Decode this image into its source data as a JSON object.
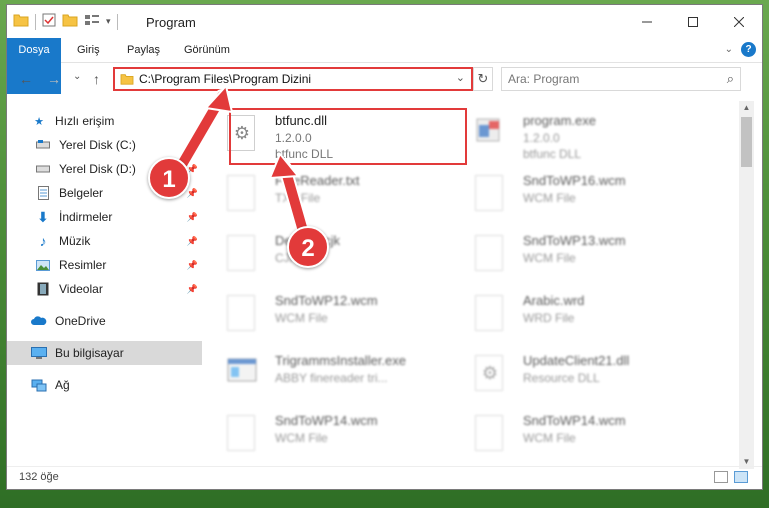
{
  "window": {
    "title": "Program"
  },
  "ribbon": {
    "tabs": [
      "Dosya",
      "Giriş",
      "Paylaş",
      "Görünüm"
    ],
    "help_label": "?"
  },
  "address": {
    "path": "C:\\Program Files\\Program Dizini",
    "search_placeholder": "Ara: Program"
  },
  "nav": {
    "items": [
      {
        "label": "Hızlı erişim",
        "icon": "star-icon",
        "pinned": false
      },
      {
        "label": "Yerel Disk (C:)",
        "icon": "drive-icon",
        "pinned": false
      },
      {
        "label": "Yerel Disk (D:)",
        "icon": "drive-icon",
        "pinned": true
      },
      {
        "label": "Belgeler",
        "icon": "document-icon",
        "pinned": true
      },
      {
        "label": "İndirmeler",
        "icon": "download-icon",
        "pinned": true
      },
      {
        "label": "Müzik",
        "icon": "music-icon",
        "pinned": true
      },
      {
        "label": "Resimler",
        "icon": "image-icon",
        "pinned": true
      },
      {
        "label": "Videolar",
        "icon": "video-icon",
        "pinned": true
      },
      {
        "label": "OneDrive",
        "icon": "cloud-icon",
        "pinned": false
      },
      {
        "label": "Bu bilgisayar",
        "icon": "computer-icon",
        "pinned": false,
        "selected": true
      },
      {
        "label": "Ağ",
        "icon": "network-icon",
        "pinned": false
      }
    ]
  },
  "files": [
    {
      "name": "btfunc.dll",
      "sub1": "1.2.0.0",
      "sub2": "btfunc DLL",
      "highlight": true
    },
    {
      "name": "program.exe",
      "sub1": "1.2.0.0",
      "sub2": "btfunc DLL"
    },
    {
      "name": "FineReader.txt",
      "sub1": "TXT File",
      "sub2": ""
    },
    {
      "name": "SndToWP16.wcm",
      "sub1": "WCM File",
      "sub2": ""
    },
    {
      "name": "De...ont.cjk",
      "sub1": "CJK File",
      "sub2": ""
    },
    {
      "name": "SndToWP13.wcm",
      "sub1": "WCM File",
      "sub2": ""
    },
    {
      "name": "SndToWP12.wcm",
      "sub1": "WCM File",
      "sub2": ""
    },
    {
      "name": "Arabic.wrd",
      "sub1": "WRD File",
      "sub2": ""
    },
    {
      "name": "TrigrammsInstaller.exe",
      "sub1": "ABBY finereader tri...",
      "sub2": ""
    },
    {
      "name": "UpdateClient21.dll",
      "sub1": "Resource DLL",
      "sub2": ""
    },
    {
      "name": "SndToWP14.wcm",
      "sub1": "WCM File",
      "sub2": ""
    },
    {
      "name": "SndToWP14.wcm",
      "sub1": "WCM File",
      "sub2": ""
    }
  ],
  "status": {
    "count": "132 öğe"
  },
  "annotations": {
    "step1": "1",
    "step2": "2"
  },
  "colors": {
    "accent": "#1979ca",
    "annotation": "#e23a3a"
  }
}
